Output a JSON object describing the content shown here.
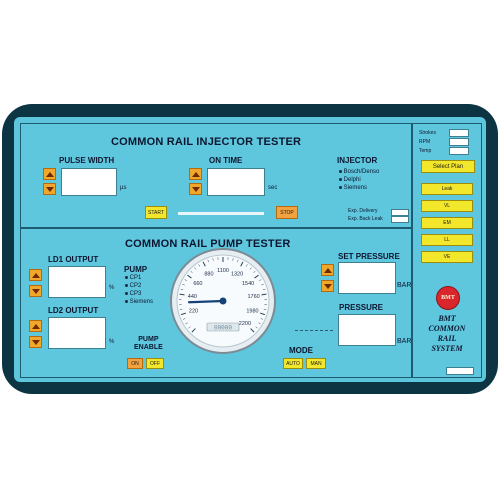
{
  "injector_tester": {
    "title": "COMMON RAIL INJECTOR TESTER",
    "pulse_width_label": "PULSE WIDTH",
    "pulse_width_unit": "µs",
    "on_time_label": "ON TIME",
    "on_time_unit": "sec",
    "injector_label": "INJECTOR",
    "injector_options": [
      "Bosch/Denso",
      "Delphi",
      "Siemens"
    ],
    "start_label": "START",
    "stop_label": "STOP",
    "exp_delivery_label": "Exp. Delivery",
    "exp_back_leak_label": "Exp. Back Leak"
  },
  "pump_tester": {
    "title": "COMMON RAIL PUMP TESTER",
    "ld1_label": "LD1 OUTPUT",
    "ld2_label": "LD2 OUTPUT",
    "percent_unit": "%",
    "pump_label": "PUMP",
    "pump_options": [
      "CP1",
      "CP2",
      "CP3",
      "Siemens"
    ],
    "pump_enable_label": "PUMP\nENABLE",
    "on_label": "ON",
    "off_label": "OFF",
    "set_pressure_label": "SET PRESSURE",
    "pressure_label": "PRESSURE",
    "bar_unit": "BAR",
    "mode_label": "MODE",
    "auto_label": "AUTO",
    "man_label": "MAN"
  },
  "gauge": {
    "ticks": [
      "220",
      "440",
      "660",
      "880",
      "1100",
      "1320",
      "1540",
      "1760",
      "1980",
      "2200"
    ],
    "readout": "00000",
    "needle_value": 350
  },
  "sidebar": {
    "strokes_label": "Strokes",
    "rpm_label": "RPM",
    "temp_label": "Temp",
    "select_plan_label": "Select Plan",
    "buttons": [
      "Leak",
      "VL",
      "EM",
      "LL",
      "VE"
    ],
    "logo_text": "BMT",
    "system_name": "BMT\nCOMMON\nRAIL\nSYSTEM"
  },
  "colors": {
    "screen": "#5ec6dc",
    "bezel": "#0c3443",
    "button_yellow": "#f3e72c",
    "button_orange": "#f2a23e",
    "logo_red": "#d8262c"
  }
}
